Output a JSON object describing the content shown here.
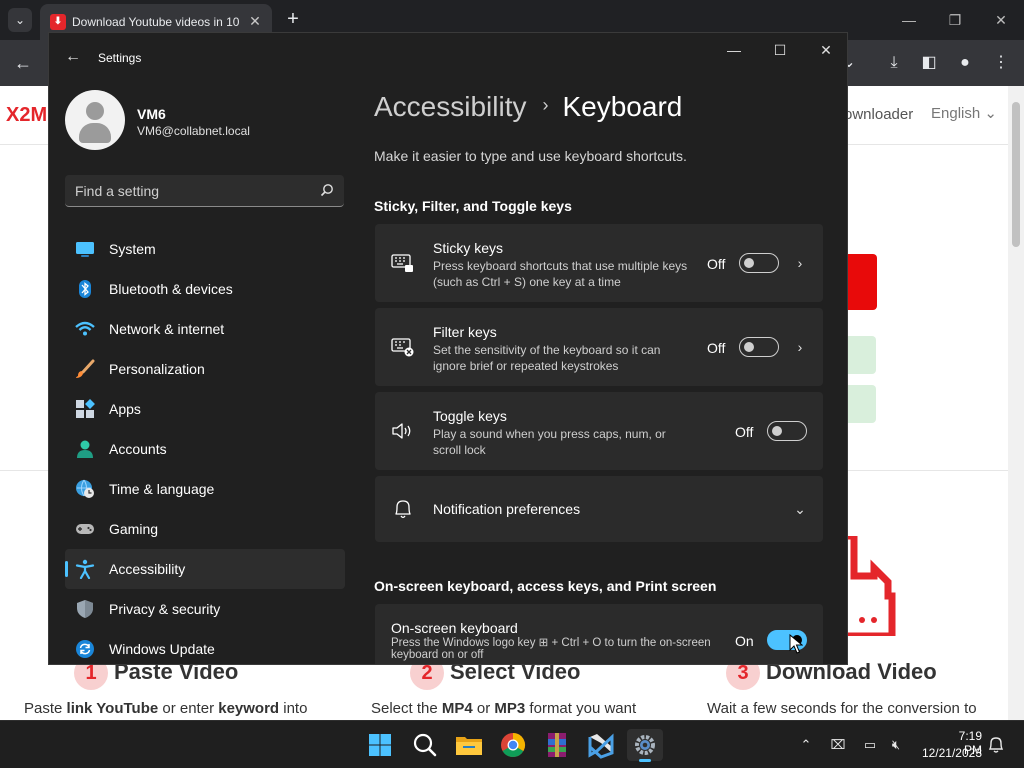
{
  "browser": {
    "tab_title": "Download Youtube videos in 10",
    "page": {
      "logo": "X2M",
      "nav_link": "ownloader",
      "language": "English",
      "steps": [
        {
          "num": "1",
          "title": "Paste Video",
          "desc_pre": "Paste ",
          "desc_b1": "link YouTube",
          "desc_mid": " or enter ",
          "desc_b2": "keyword",
          "desc_post": " into"
        },
        {
          "num": "2",
          "title": "Select Video",
          "desc_pre": "Select the ",
          "desc_b1": "MP4",
          "desc_mid": " or ",
          "desc_b2": "MP3",
          "desc_post": " format you want"
        },
        {
          "num": "3",
          "title": "Download Video",
          "desc_pre": "Wait a few seconds for the conversion to",
          "desc_b1": "",
          "desc_mid": "",
          "desc_b2": "",
          "desc_post": ""
        }
      ]
    }
  },
  "settings": {
    "window_title": "Settings",
    "user": {
      "name": "VM6",
      "email": "VM6@collabnet.local"
    },
    "search": {
      "placeholder": "Find a setting"
    },
    "nav": [
      {
        "label": "System",
        "icon": "system-icon"
      },
      {
        "label": "Bluetooth & devices",
        "icon": "bluetooth-icon"
      },
      {
        "label": "Network & internet",
        "icon": "network-icon"
      },
      {
        "label": "Personalization",
        "icon": "brush-icon"
      },
      {
        "label": "Apps",
        "icon": "apps-icon"
      },
      {
        "label": "Accounts",
        "icon": "accounts-icon"
      },
      {
        "label": "Time & language",
        "icon": "globe-clock-icon"
      },
      {
        "label": "Gaming",
        "icon": "gamepad-icon"
      },
      {
        "label": "Accessibility",
        "icon": "accessibility-icon",
        "selected": true
      },
      {
        "label": "Privacy & security",
        "icon": "shield-icon"
      },
      {
        "label": "Windows Update",
        "icon": "update-icon"
      }
    ],
    "breadcrumb": {
      "parent": "Accessibility",
      "separator": "›",
      "current": "Keyboard"
    },
    "description": "Make it easier to type and use keyboard shortcuts.",
    "section1": "Sticky, Filter, and Toggle keys",
    "cards": [
      {
        "title": "Sticky keys",
        "desc": "Press keyboard shortcuts that use multiple keys (such as Ctrl + S) one key at a time",
        "state": "Off",
        "icon": "sticky-keys-icon"
      },
      {
        "title": "Filter keys",
        "desc": "Set the sensitivity of the keyboard so it can ignore brief or repeated keystrokes",
        "state": "Off",
        "icon": "filter-keys-icon"
      },
      {
        "title": "Toggle keys",
        "desc": "Play a sound when you press caps, num, or scroll lock",
        "state": "Off",
        "icon": "speaker-icon"
      }
    ],
    "notification": {
      "title": "Notification preferences",
      "icon": "bell-icon"
    },
    "section2": "On-screen keyboard, access keys, and Print screen",
    "osk": {
      "title": "On-screen keyboard",
      "desc": "Press the Windows logo key ⊞ + Ctrl + O to turn the on-screen keyboard on or off",
      "state": "On"
    }
  },
  "taskbar": {
    "apps": [
      "windows-start-icon",
      "search-icon",
      "file-explorer-icon",
      "chrome-icon",
      "winrar-icon",
      "vscode-icon",
      "settings-gear-icon"
    ],
    "time": "7:19 PM",
    "date": "12/21/2023"
  }
}
